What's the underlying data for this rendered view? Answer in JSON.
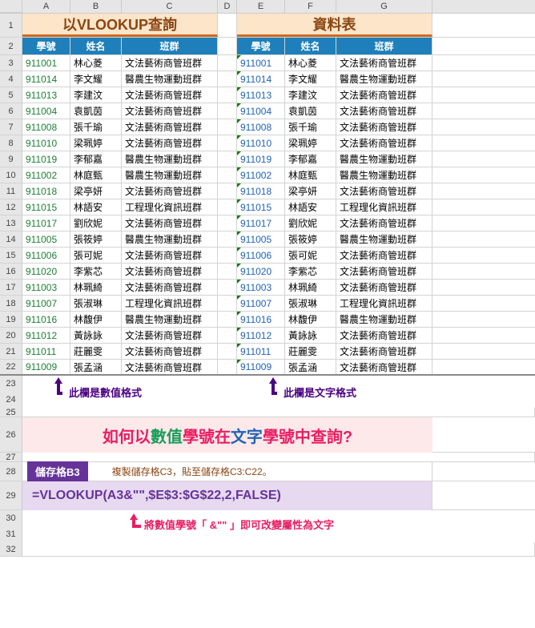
{
  "columns": [
    "A",
    "B",
    "C",
    "D",
    "E",
    "F",
    "G"
  ],
  "title_left": "以VLOOKUP查詢",
  "title_right": "資料表",
  "headers": {
    "id": "學號",
    "name": "姓名",
    "group": "班群"
  },
  "rows_left": [
    {
      "id": "911001",
      "name": "林心菱",
      "group": "文法藝術商管班群"
    },
    {
      "id": "911014",
      "name": "李文耀",
      "group": "醫農生物運動班群"
    },
    {
      "id": "911013",
      "name": "李建汶",
      "group": "文法藝術商管班群"
    },
    {
      "id": "911004",
      "name": "袁凱茵",
      "group": "文法藝術商管班群"
    },
    {
      "id": "911008",
      "name": "張千瑜",
      "group": "文法藝術商管班群"
    },
    {
      "id": "911010",
      "name": "梁珮婷",
      "group": "文法藝術商管班群"
    },
    {
      "id": "911019",
      "name": "李郁嘉",
      "group": "醫農生物運動班群"
    },
    {
      "id": "911002",
      "name": "林庭甄",
      "group": "醫農生物運動班群"
    },
    {
      "id": "911018",
      "name": "梁亭妍",
      "group": "文法藝術商管班群"
    },
    {
      "id": "911015",
      "name": "林語安",
      "group": "工程理化資訊班群"
    },
    {
      "id": "911017",
      "name": "劉欣妮",
      "group": "文法藝術商管班群"
    },
    {
      "id": "911005",
      "name": "張筱婷",
      "group": "醫農生物運動班群"
    },
    {
      "id": "911006",
      "name": "張可妮",
      "group": "文法藝術商管班群"
    },
    {
      "id": "911020",
      "name": "李紫芯",
      "group": "文法藝術商管班群"
    },
    {
      "id": "911003",
      "name": "林珮綺",
      "group": "文法藝術商管班群"
    },
    {
      "id": "911007",
      "name": "張淑琳",
      "group": "工程理化資訊班群"
    },
    {
      "id": "911016",
      "name": "林馥伊",
      "group": "醫農生物運動班群"
    },
    {
      "id": "911012",
      "name": "黃詠詠",
      "group": "文法藝術商管班群"
    },
    {
      "id": "911011",
      "name": "莊麗雯",
      "group": "文法藝術商管班群"
    },
    {
      "id": "911009",
      "name": "張孟涵",
      "group": "文法藝術商管班群"
    }
  ],
  "rows_right": [
    {
      "id": "911001",
      "name": "林心菱",
      "group": "文法藝術商管班群"
    },
    {
      "id": "911014",
      "name": "李文耀",
      "group": "醫農生物運動班群"
    },
    {
      "id": "911013",
      "name": "李建汶",
      "group": "文法藝術商管班群"
    },
    {
      "id": "911004",
      "name": "袁凱茵",
      "group": "文法藝術商管班群"
    },
    {
      "id": "911008",
      "name": "張千瑜",
      "group": "文法藝術商管班群"
    },
    {
      "id": "911010",
      "name": "梁珮婷",
      "group": "文法藝術商管班群"
    },
    {
      "id": "911019",
      "name": "李郁嘉",
      "group": "醫農生物運動班群"
    },
    {
      "id": "911002",
      "name": "林庭甄",
      "group": "醫農生物運動班群"
    },
    {
      "id": "911018",
      "name": "梁亭妍",
      "group": "文法藝術商管班群"
    },
    {
      "id": "911015",
      "name": "林語安",
      "group": "工程理化資訊班群"
    },
    {
      "id": "911017",
      "name": "劉欣妮",
      "group": "文法藝術商管班群"
    },
    {
      "id": "911005",
      "name": "張筱婷",
      "group": "醫農生物運動班群"
    },
    {
      "id": "911006",
      "name": "張可妮",
      "group": "文法藝術商管班群"
    },
    {
      "id": "911020",
      "name": "李紫芯",
      "group": "文法藝術商管班群"
    },
    {
      "id": "911003",
      "name": "林珮綺",
      "group": "文法藝術商管班群"
    },
    {
      "id": "911007",
      "name": "張淑琳",
      "group": "工程理化資訊班群"
    },
    {
      "id": "911016",
      "name": "林馥伊",
      "group": "醫農生物運動班群"
    },
    {
      "id": "911012",
      "name": "黃詠詠",
      "group": "文法藝術商管班群"
    },
    {
      "id": "911011",
      "name": "莊麗雯",
      "group": "文法藝術商管班群"
    },
    {
      "id": "911009",
      "name": "張孟涵",
      "group": "文法藝術商管班群"
    }
  ],
  "annotation_left": "此欄是數值格式",
  "annotation_right": "此欄是文字格式",
  "question": {
    "p1": "如何以",
    "p2": "數值",
    "p3": "學號在",
    "p4": "文字",
    "p5": "學號中查詢?"
  },
  "cell_label": "儲存格B3",
  "instruction": "複製儲存格C3，貼至儲存格C3:C22。",
  "formula": "=VLOOKUP(A3&\"\",$E$3:$G$22,2,FALSE)",
  "note": "將數值學號「 &\"\" 」即可改變屬性為文字"
}
